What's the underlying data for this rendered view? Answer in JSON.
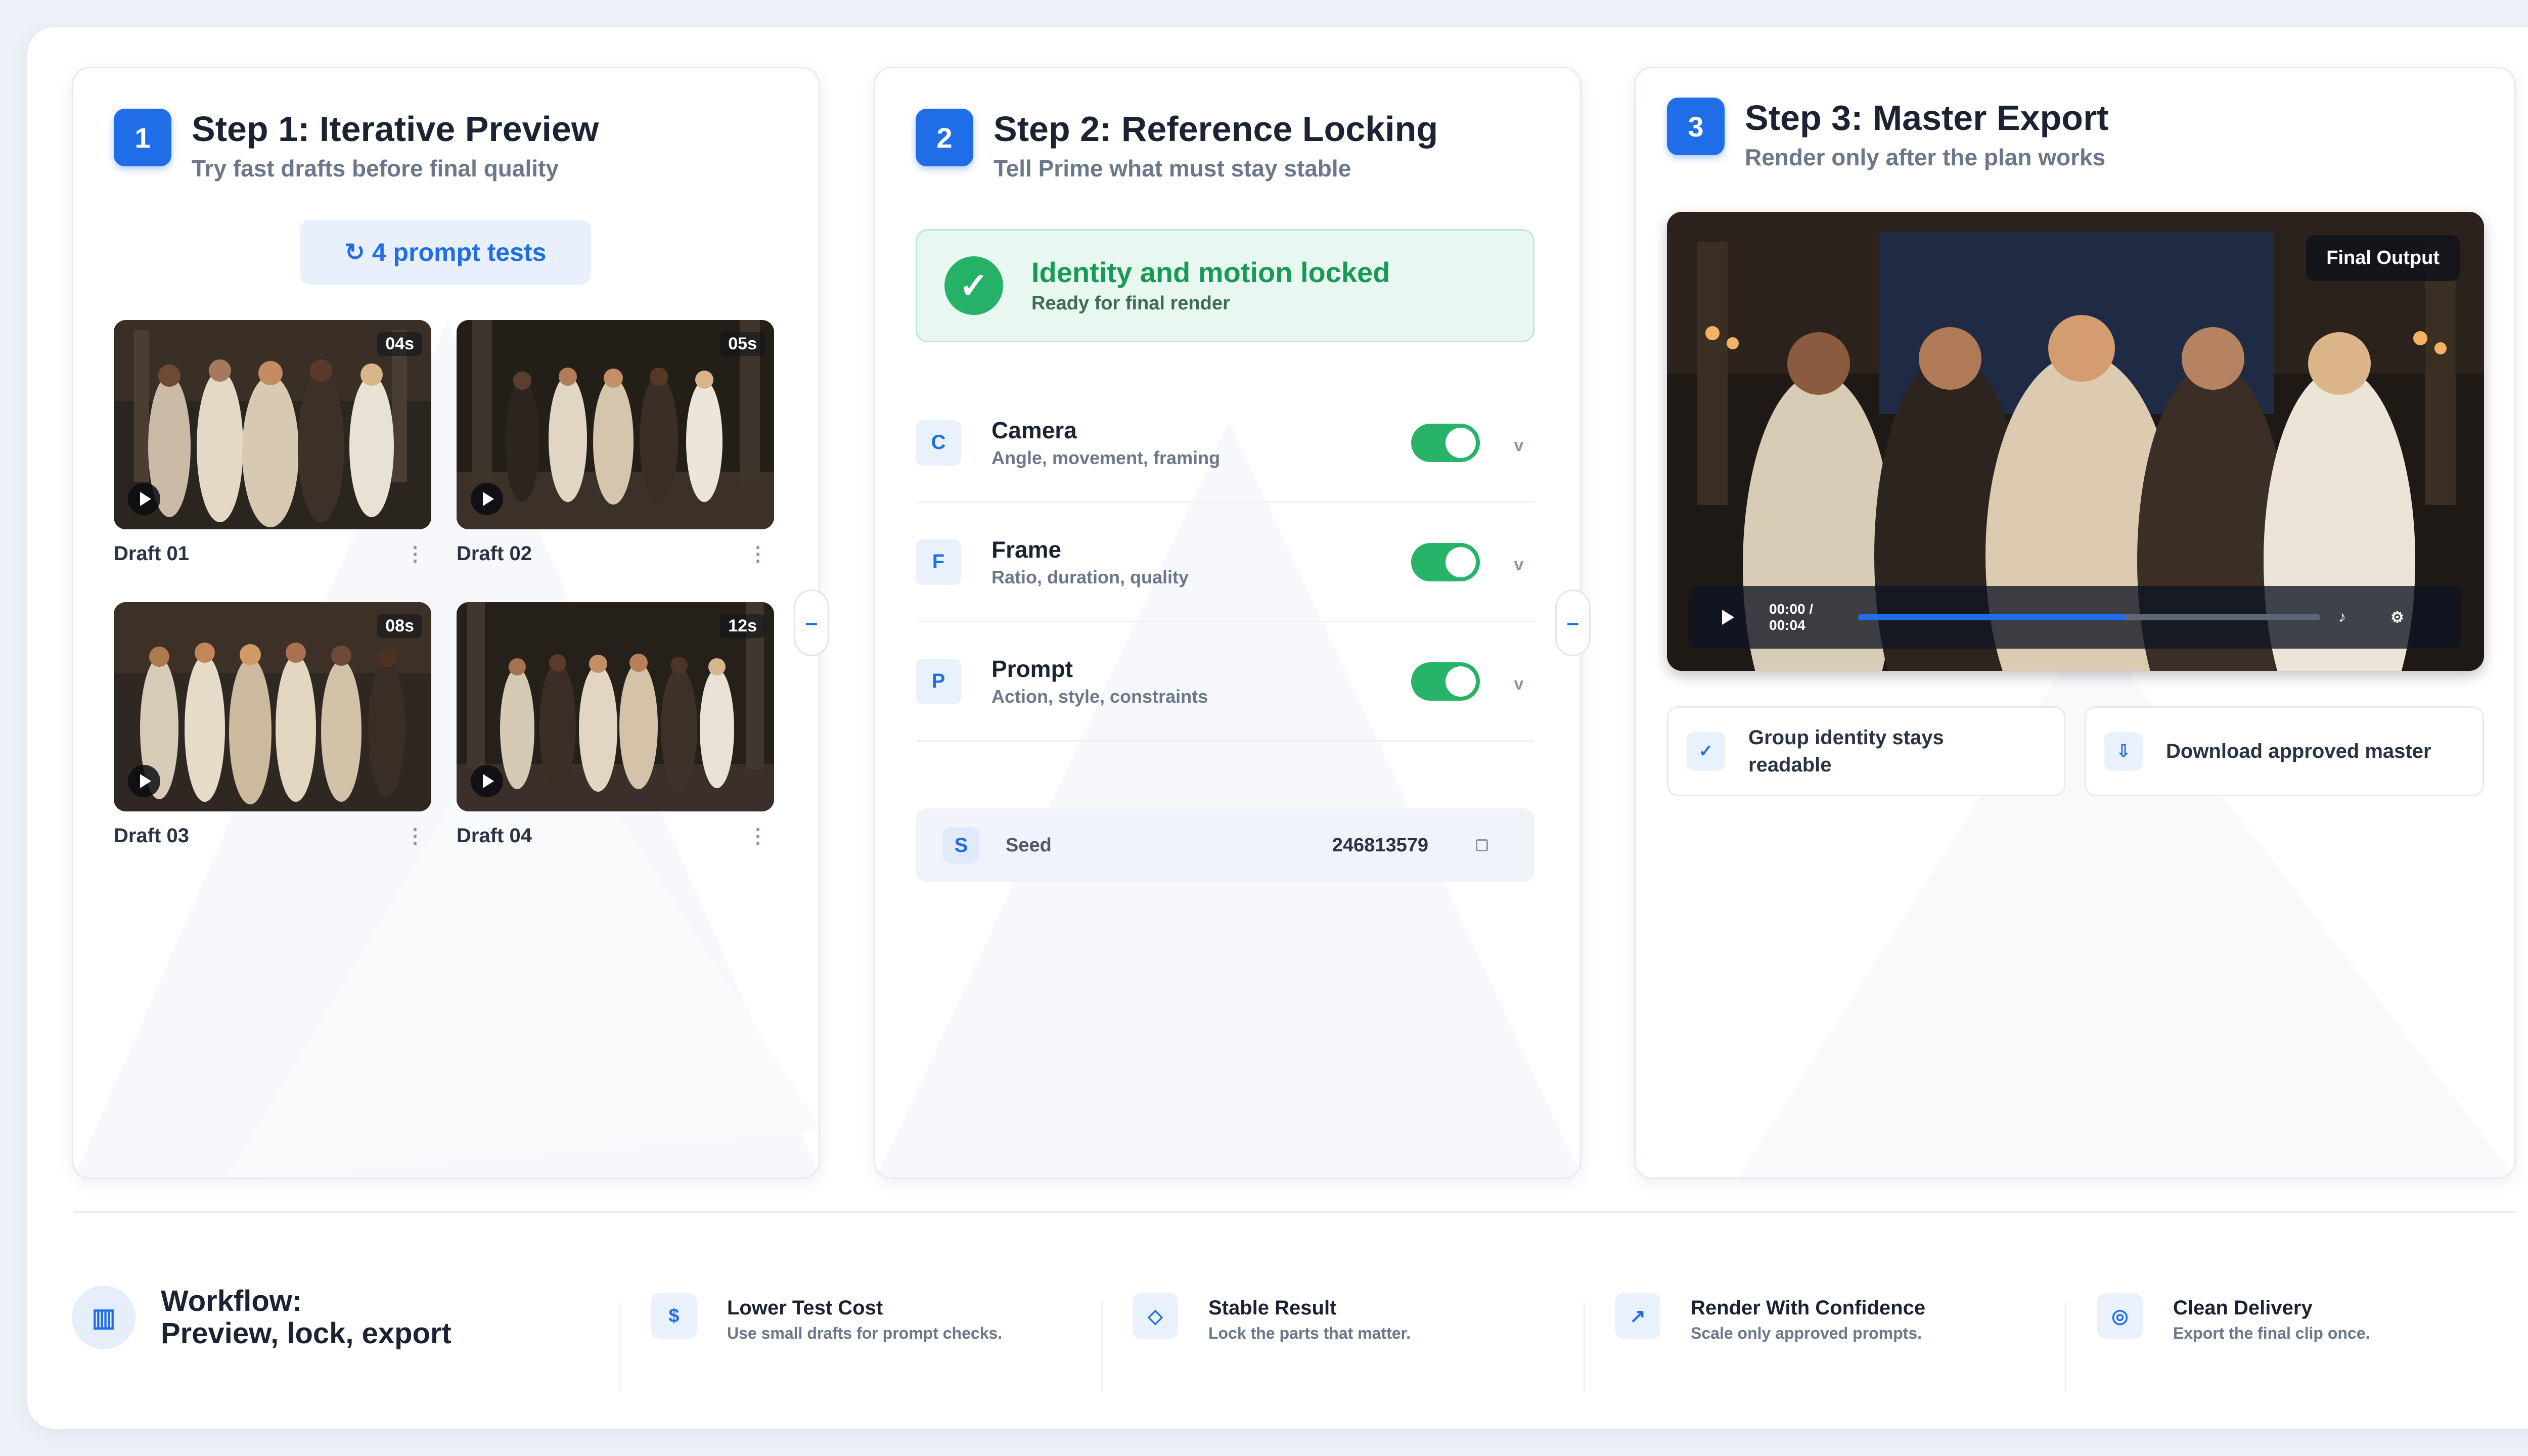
{
  "steps": [
    {
      "number": "1",
      "title": "Step 1: Iterative Preview",
      "subtitle": "Try fast drafts before final quality"
    },
    {
      "number": "2",
      "title": "Step 2: Reference Locking",
      "subtitle": "Tell Prime what must stay stable"
    },
    {
      "number": "3",
      "title": "Step 3: Master Export",
      "subtitle": "Render only after the plan works"
    }
  ],
  "preview": {
    "refresh_icon": "refresh-icon",
    "refresh_glyph": "↻",
    "prompt_tests_label": "4 prompt tests",
    "drafts": [
      {
        "label": "Draft 01",
        "duration": "04s"
      },
      {
        "label": "Draft 02",
        "duration": "05s"
      },
      {
        "label": "Draft 03",
        "duration": "08s"
      },
      {
        "label": "Draft 04",
        "duration": "12s"
      }
    ],
    "kebab_glyph": "⋮"
  },
  "locking": {
    "status_title": "Identity and motion locked",
    "status_sub": "Ready for final render",
    "check_glyph": "✓",
    "rows": [
      {
        "letter": "C",
        "title": "Camera",
        "sub": "Angle, movement, framing",
        "enabled": true
      },
      {
        "letter": "F",
        "title": "Frame",
        "sub": "Ratio, duration, quality",
        "enabled": true
      },
      {
        "letter": "P",
        "title": "Prompt",
        "sub": "Action, style, constraints",
        "enabled": true
      }
    ],
    "chevron_glyph": "v",
    "seed": {
      "letter": "S",
      "label": "Seed",
      "value": "246813579"
    }
  },
  "export": {
    "final_tag": "Final Output",
    "player": {
      "time_current": "00:00 /",
      "time_total": "00:04",
      "progress_fraction": 0.58,
      "music_glyph": "♪",
      "settings_glyph": "⚙"
    },
    "features": [
      {
        "glyph": "✓",
        "label": "Group identity stays readable"
      },
      {
        "glyph": "⇩",
        "label": "Download approved master"
      }
    ]
  },
  "footer": {
    "workflow_line1": "Workflow:",
    "workflow_line2": "Preview, lock, export",
    "workflow_glyph": "▥",
    "items": [
      {
        "glyph": "$",
        "title": "Lower Test Cost",
        "sub": "Use small drafts for prompt checks."
      },
      {
        "glyph": "◇",
        "title": "Stable Result",
        "sub": "Lock the parts that matter."
      },
      {
        "glyph": "↗",
        "title": "Render With Confidence",
        "sub": "Scale only approved prompts."
      },
      {
        "glyph": "◎",
        "title": "Clean Delivery",
        "sub": "Export the final clip once."
      }
    ]
  },
  "colors": {
    "accent": "#1f6ee8",
    "success": "#25b266",
    "toggle_on": "#28b468"
  }
}
